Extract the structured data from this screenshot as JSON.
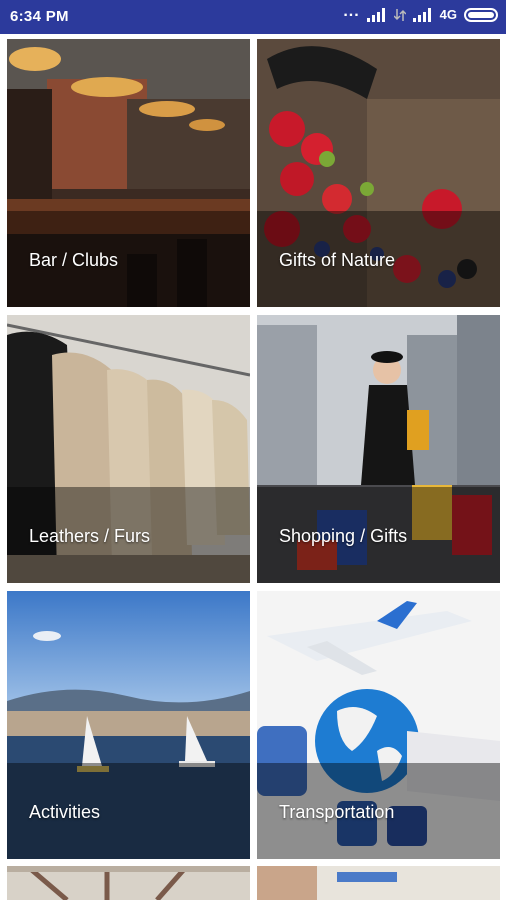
{
  "status_bar": {
    "time": "6:34 PM",
    "signal_dots": "...",
    "network": "4G"
  },
  "categories": [
    {
      "label": "Bar / Clubs",
      "image": "bar-interior"
    },
    {
      "label": "Gifts of Nature",
      "image": "strawberries-basket"
    },
    {
      "label": "Leathers / Furs",
      "image": "fur-coats-rack"
    },
    {
      "label": "Shopping / Gifts",
      "image": "shopping-woman-city"
    },
    {
      "label": "Activities",
      "image": "sailboats-lake"
    },
    {
      "label": "Transportation",
      "image": "airplane-globe-train"
    },
    {
      "label": "",
      "image": "partial-ceiling"
    },
    {
      "label": "",
      "image": "partial-tickets"
    }
  ],
  "colors": {
    "status_bar": "#2c3a9c",
    "label_overlay": "rgba(0,0,0,0.42)"
  }
}
